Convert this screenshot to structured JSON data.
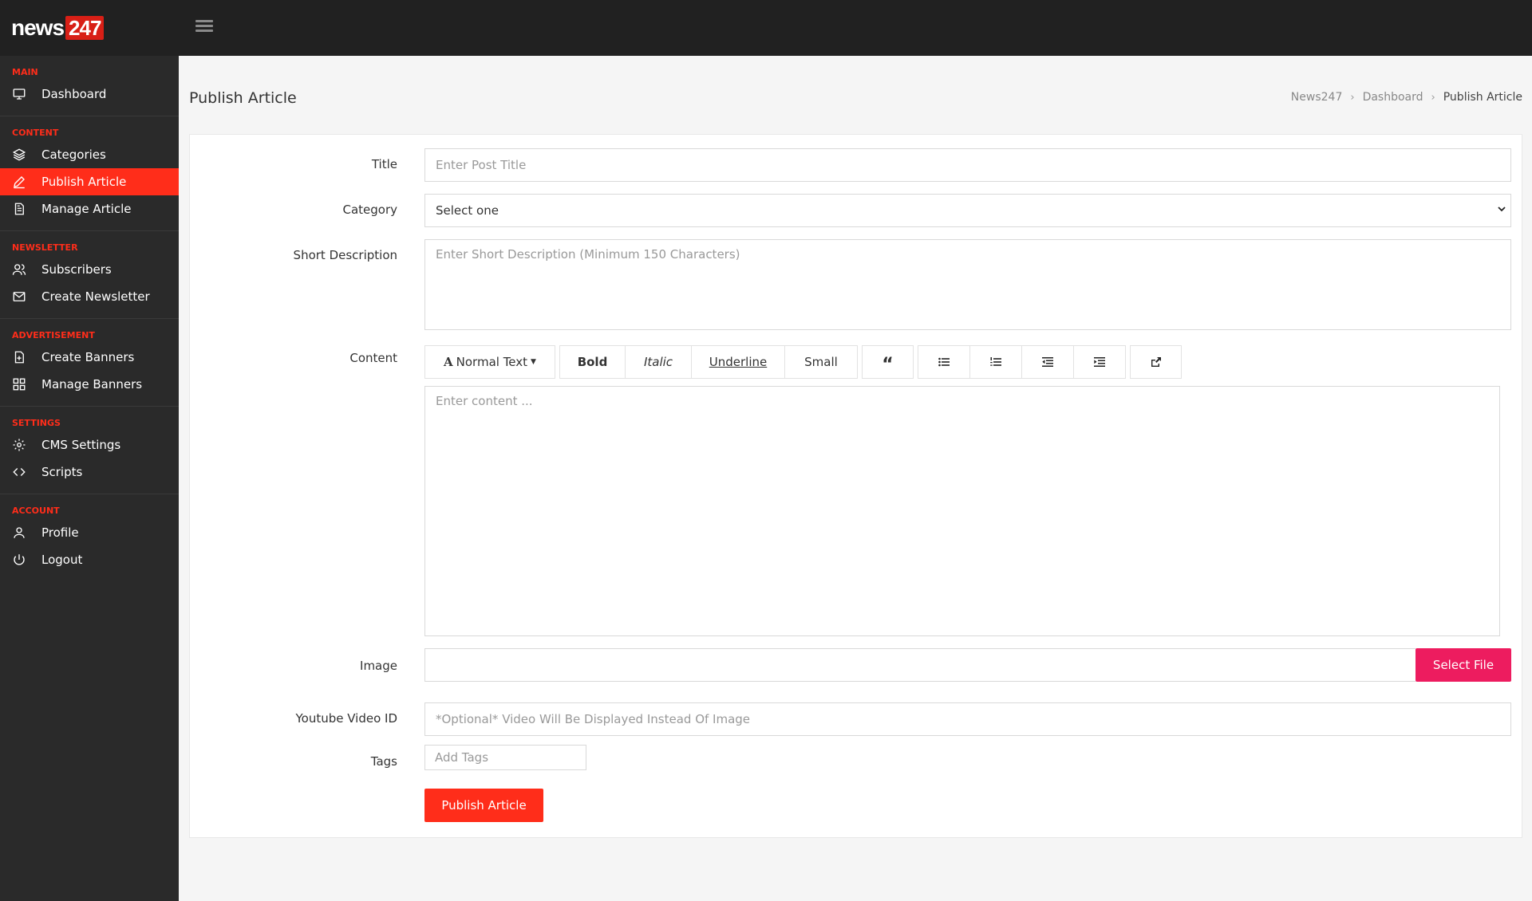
{
  "brand": {
    "name_part": "news",
    "number_part": "247"
  },
  "sidebar": {
    "sections": [
      {
        "heading": "MAIN",
        "items": [
          {
            "label": "Dashboard",
            "icon": "monitor-icon"
          }
        ]
      },
      {
        "heading": "CONTENT",
        "items": [
          {
            "label": "Categories",
            "icon": "layers-icon"
          },
          {
            "label": "Publish Article",
            "icon": "pencil-icon",
            "active": true
          },
          {
            "label": "Manage Article",
            "icon": "document-icon"
          }
        ]
      },
      {
        "heading": "NEWSLETTER",
        "items": [
          {
            "label": "Subscribers",
            "icon": "users-icon"
          },
          {
            "label": "Create Newsletter",
            "icon": "envelope-icon"
          }
        ]
      },
      {
        "heading": "ADVERTISEMENT",
        "items": [
          {
            "label": "Create Banners",
            "icon": "file-plus-icon"
          },
          {
            "label": "Manage Banners",
            "icon": "grid-icon"
          }
        ]
      },
      {
        "heading": "SETTINGS",
        "items": [
          {
            "label": "CMS Settings",
            "icon": "gear-icon"
          },
          {
            "label": "Scripts",
            "icon": "code-icon"
          }
        ]
      },
      {
        "heading": "ACCOUNT",
        "items": [
          {
            "label": "Profile",
            "icon": "user-icon"
          },
          {
            "label": "Logout",
            "icon": "power-icon"
          }
        ]
      }
    ]
  },
  "page": {
    "title": "Publish Article",
    "breadcrumb": [
      "News247",
      "Dashboard",
      "Publish Article"
    ]
  },
  "form": {
    "title": {
      "label": "Title",
      "placeholder": "Enter Post Title"
    },
    "category": {
      "label": "Category",
      "value": "Select one"
    },
    "short_description": {
      "label": "Short Description",
      "placeholder": "Enter Short Description (Minimum 150 Characters)"
    },
    "content": {
      "label": "Content",
      "placeholder": "Enter content ...",
      "toolbar": {
        "normal_text": "Normal Text",
        "bold": "Bold",
        "italic": "Italic",
        "underline": "Underline",
        "small": "Small"
      }
    },
    "image": {
      "label": "Image",
      "button": "Select File"
    },
    "youtube": {
      "label": "Youtube Video ID",
      "placeholder": "*Optional* Video Will Be Displayed Instead Of Image"
    },
    "tags": {
      "label": "Tags",
      "placeholder": "Add Tags"
    },
    "submit": "Publish Article"
  },
  "colors": {
    "accent": "#ff2d1a",
    "file_button": "#ed1c5f",
    "sidebar_bg": "#2a2a2a",
    "topbar_bg": "#212121"
  }
}
